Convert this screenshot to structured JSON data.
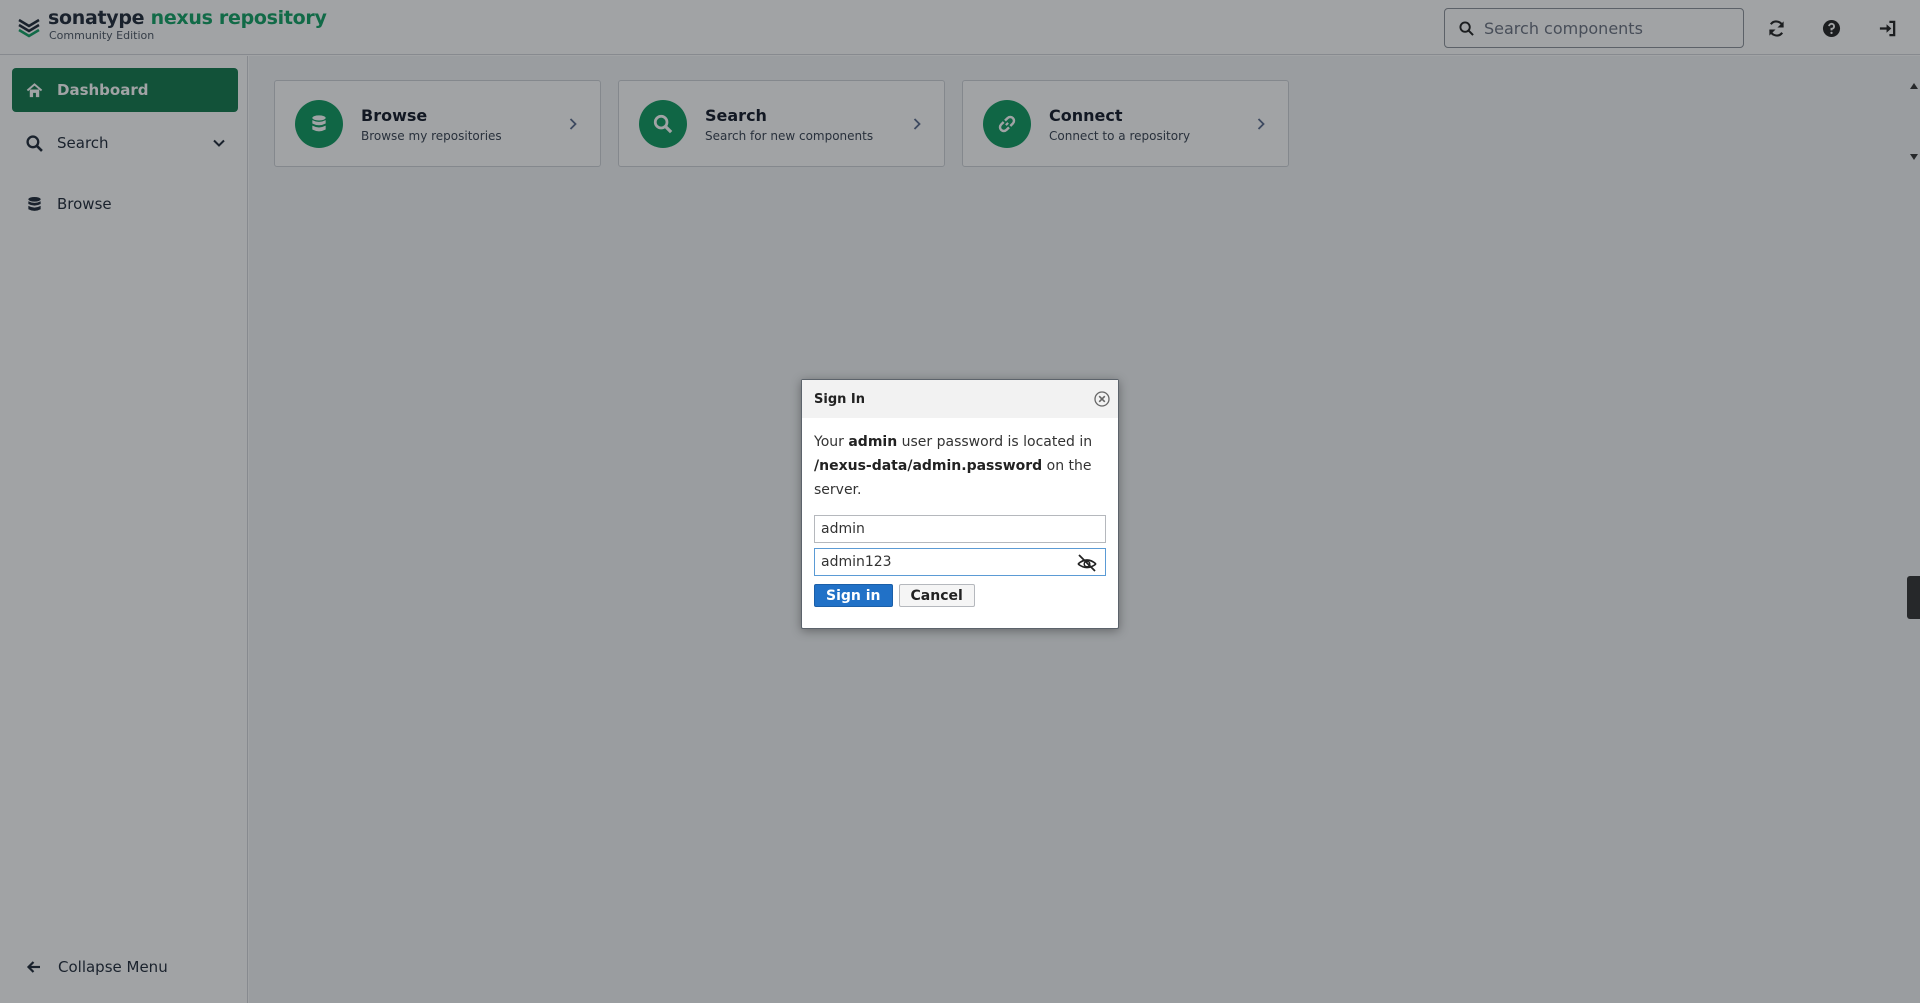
{
  "header": {
    "brand": "sonatype",
    "product": "nexus repository",
    "edition": "Community Edition",
    "search_placeholder": "Search components",
    "icons": {
      "search": "search-icon",
      "refresh": "refresh-icon",
      "help": "help-icon",
      "sign_in": "sign-in-icon"
    }
  },
  "sidebar": {
    "items": [
      {
        "label": "Dashboard",
        "icon": "home-icon",
        "active": true
      },
      {
        "label": "Search",
        "icon": "search-icon",
        "expandable": true
      },
      {
        "label": "Browse",
        "icon": "database-icon"
      }
    ],
    "collapse_label": "Collapse Menu"
  },
  "cards": [
    {
      "title": "Browse",
      "subtitle": "Browse my repositories",
      "icon": "database-icon"
    },
    {
      "title": "Search",
      "subtitle": "Search for new components",
      "icon": "search-icon"
    },
    {
      "title": "Connect",
      "subtitle": "Connect to a repository",
      "icon": "link-icon"
    }
  ],
  "dialog": {
    "title": "Sign In",
    "message": {
      "p1": "Your ",
      "user": "admin",
      "p2": " user password is located in ",
      "path": "/nexus-data/admin.password",
      "p3": " on the server."
    },
    "username_value": "admin",
    "password_value": "admin123",
    "sign_in_label": "Sign in",
    "cancel_label": "Cancel"
  },
  "colors": {
    "accent_green": "#12794b",
    "icon_green": "#0e9a5f",
    "primary_blue": "#2171c7"
  }
}
